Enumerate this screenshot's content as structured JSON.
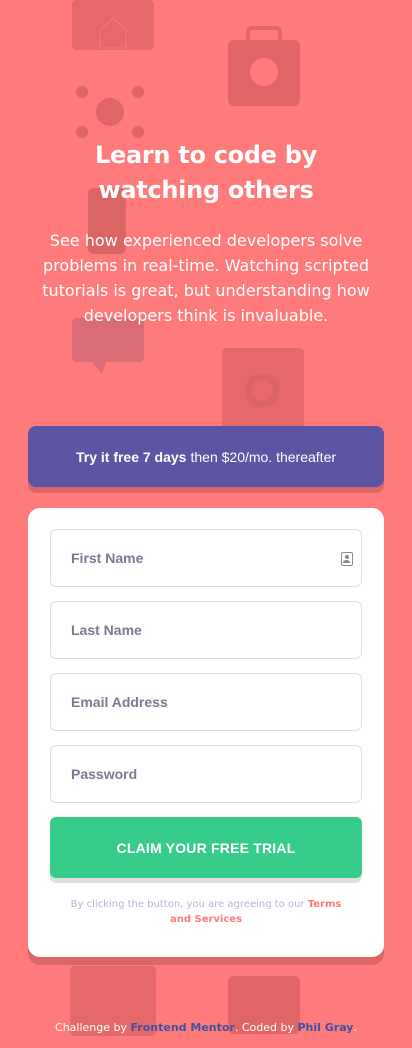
{
  "hero": {
    "title": "Learn to code by watching others",
    "description": "See how experienced developers solve problems in real-time. Watching scripted tutorials is great, but understanding how developers think is invaluable."
  },
  "offer": {
    "bold": "Try it free 7 days",
    "rest": "then $20/mo. thereafter"
  },
  "form": {
    "first_name_placeholder": "First Name",
    "last_name_placeholder": "Last Name",
    "email_placeholder": "Email Address",
    "password_placeholder": "Password",
    "submit_label": "CLAIM YOUR FREE TRIAL",
    "terms_prefix": "By clicking the button, you are agreeing to our",
    "terms_link": "Terms and Services"
  },
  "footer": {
    "prefix": "Challenge by",
    "challenge_link": "Frontend Mentor",
    "middle": ". Coded by",
    "author_link": "Phil Gray",
    "suffix": "."
  },
  "colors": {
    "background": "#ff7a7a",
    "offer_bg": "#5e54a4",
    "button_green": "#38cc8b",
    "card_bg": "#ffffff",
    "link_blue": "#3e52a3"
  },
  "icons": [
    "contact-autofill-icon"
  ]
}
